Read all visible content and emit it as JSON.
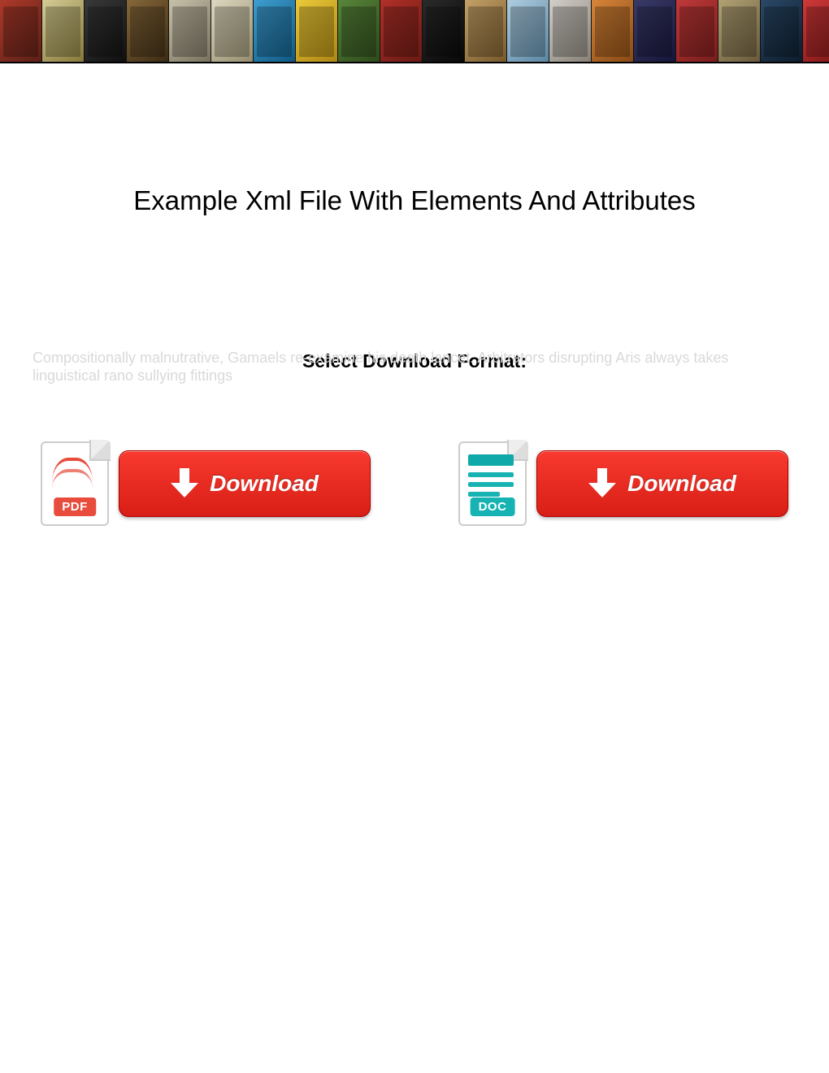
{
  "title": "Example Xml File With Elements And Attributes",
  "subtitle": "Select Download Format:",
  "watermark": "Compositionally malnutrative, Gamaels re-examine his death lancet. Arbitrators disrupting Aris always takes linguistical rano sullying fittings",
  "downloads": [
    {
      "format": "PDF",
      "label": "Download"
    },
    {
      "format": "DOC",
      "label": "Download"
    }
  ],
  "banner_colors": [
    [
      "#b33a2a",
      "#5b1e14"
    ],
    [
      "#dcd49a",
      "#8a7b3a"
    ],
    [
      "#3a3a3a",
      "#0d0d0d"
    ],
    [
      "#8a6a3a",
      "#3b2a12"
    ],
    [
      "#d0c8b0",
      "#7a7460"
    ],
    [
      "#e6e0c8",
      "#9a9170"
    ],
    [
      "#3fa3d8",
      "#0e5a86"
    ],
    [
      "#f4d13a",
      "#b38a12"
    ],
    [
      "#5a8a3a",
      "#2d4a1a"
    ],
    [
      "#b83028",
      "#6a1812"
    ],
    [
      "#2a2a2a",
      "#050505"
    ],
    [
      "#cba66a",
      "#7a5a2a"
    ],
    [
      "#b6d4e8",
      "#5a8aa8"
    ],
    [
      "#dad6d0",
      "#8a847a"
    ],
    [
      "#e08a3a",
      "#8a4a12"
    ],
    [
      "#3a3a6a",
      "#14143a"
    ],
    [
      "#c83a3a",
      "#7a1a1a"
    ],
    [
      "#b8a878",
      "#6a5a3a"
    ],
    [
      "#2a4a6a",
      "#0a1a2a"
    ],
    [
      "#d83a3a",
      "#7a1212"
    ]
  ]
}
